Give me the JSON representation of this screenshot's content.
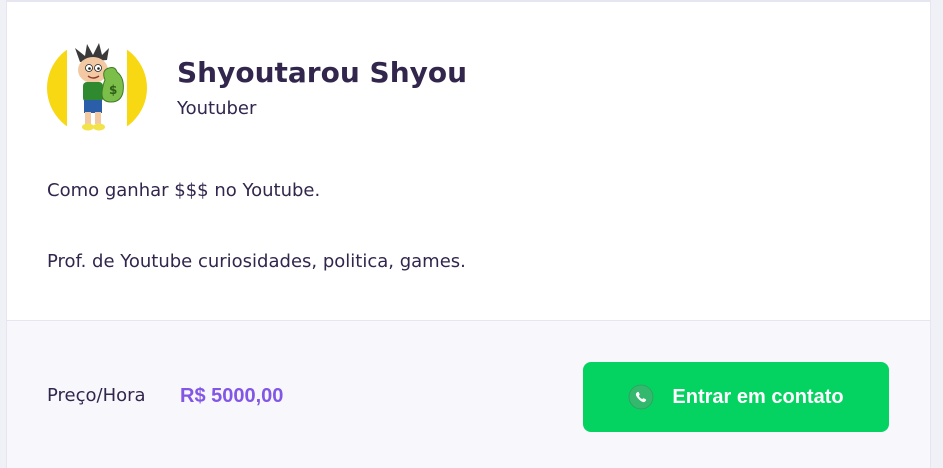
{
  "profile": {
    "name": "Shyoutarou Shyou",
    "subject": "Youtuber",
    "avatar": "cartoon-boy-with-money-bag-avatar"
  },
  "bio": [
    "Como ganhar $$$ no Youtube.",
    "Prof. de Youtube curiosidades, politica, games."
  ],
  "footer": {
    "price_label": "Preço/Hora",
    "price_value": "R$ 5000,00",
    "contact_label": "Entrar em contato",
    "contact_icon": "whatsapp-icon"
  },
  "colors": {
    "text": "#32264d",
    "accent": "#8257e5",
    "button": "#04d361",
    "footer_bg": "#f8f8fc"
  }
}
